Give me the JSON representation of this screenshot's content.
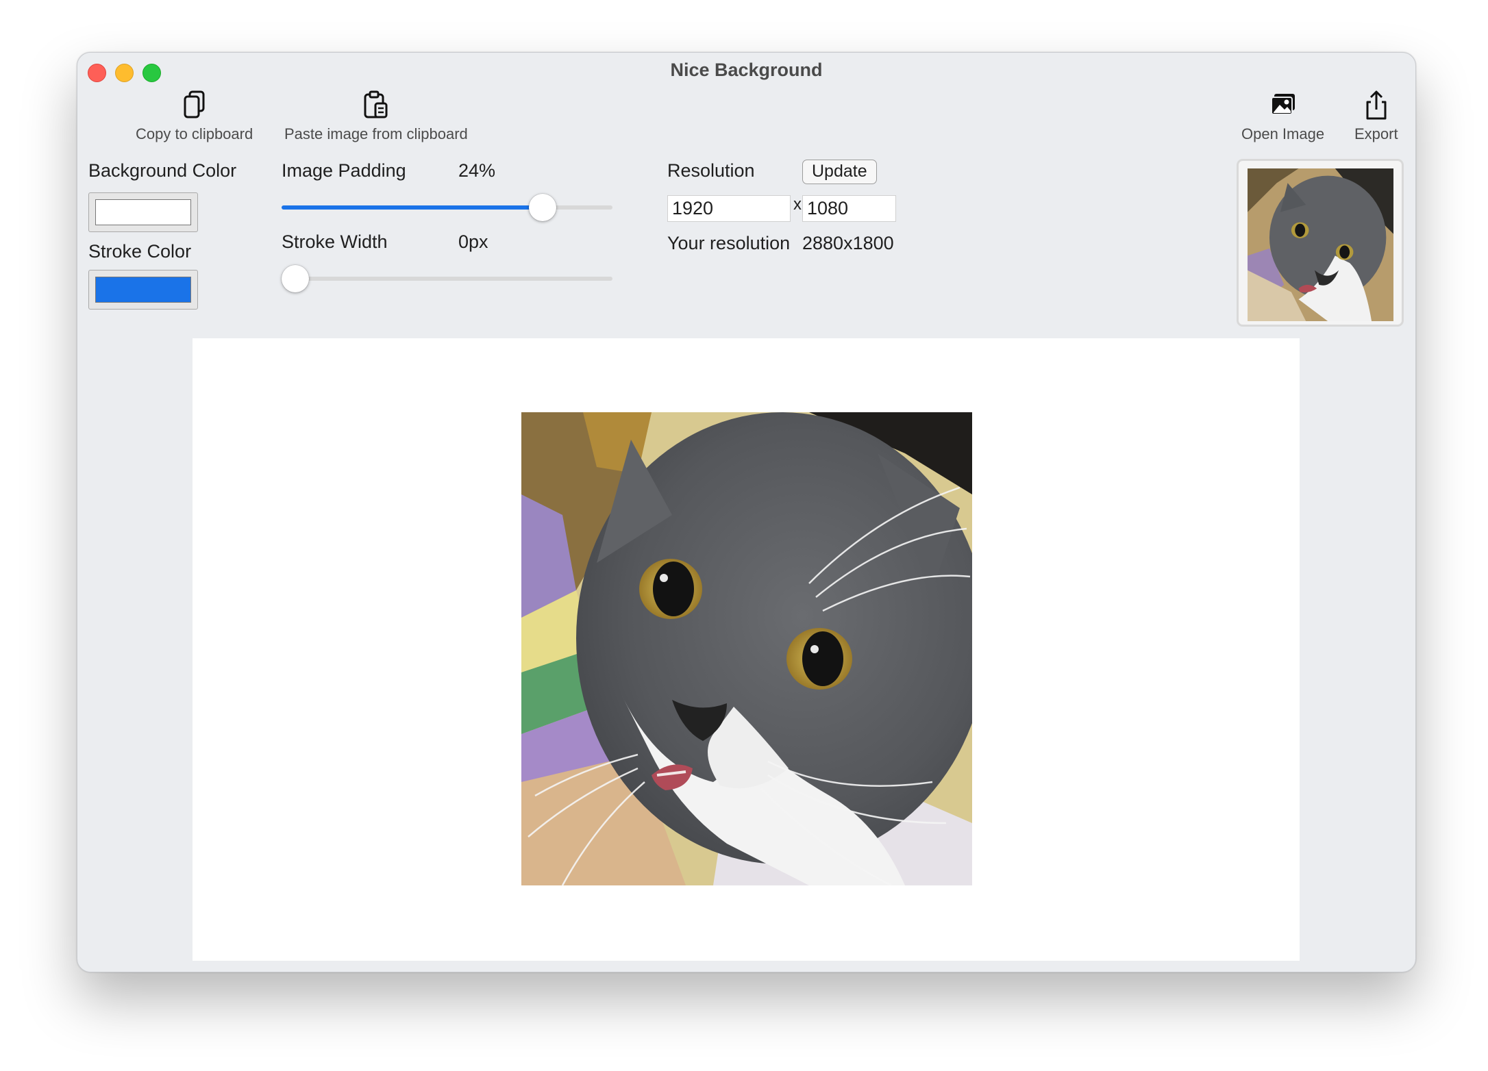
{
  "window": {
    "title": "Nice Background"
  },
  "toolbar": {
    "copy_label": "Copy to clipboard",
    "paste_label": "Paste image from clipboard",
    "open_label": "Open Image",
    "export_label": "Export"
  },
  "settings": {
    "background_color_label": "Background Color",
    "background_color": "#ffffff",
    "stroke_color_label": "Stroke Color",
    "stroke_color": "#1a73e8",
    "padding_label": "Image Padding",
    "padding_value": "24%",
    "padding_fraction": 0.815,
    "stroke_width_label": "Stroke Width",
    "stroke_width_value": "0px",
    "stroke_width_fraction": 0.0,
    "accent_color": "#1a73e8"
  },
  "resolution": {
    "label": "Resolution",
    "update_label": "Update",
    "width": "1920",
    "separator": "x",
    "height": "1080",
    "your_resolution_label": "Your resolution",
    "your_resolution_value": "2880x1800"
  },
  "icons": {
    "copy": "copy-icon",
    "paste": "clipboard-paste-icon",
    "open": "photo-stack-icon",
    "export": "share-icon"
  }
}
